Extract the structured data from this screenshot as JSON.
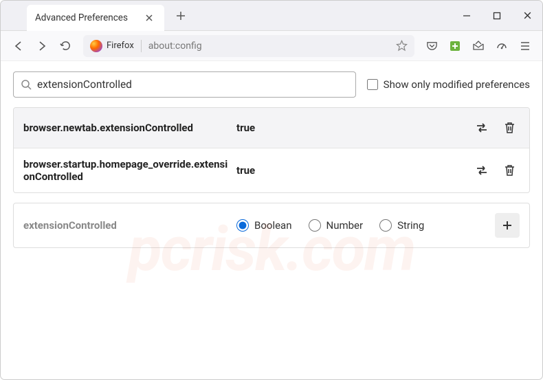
{
  "window": {
    "tab_title": "Advanced Preferences"
  },
  "urlbar": {
    "identity": "Firefox",
    "url": "about:config"
  },
  "search": {
    "value": "extensionControlled",
    "checkbox_label": "Show only modified preferences"
  },
  "prefs": [
    {
      "name": "browser.newtab.extensionControlled",
      "value": "true"
    },
    {
      "name": "browser.startup.homepage_override.extensionControlled",
      "value": "true"
    }
  ],
  "add": {
    "name": "extensionControlled",
    "types": {
      "boolean": "Boolean",
      "number": "Number",
      "string": "String"
    }
  },
  "watermark": "pcrisk.com"
}
